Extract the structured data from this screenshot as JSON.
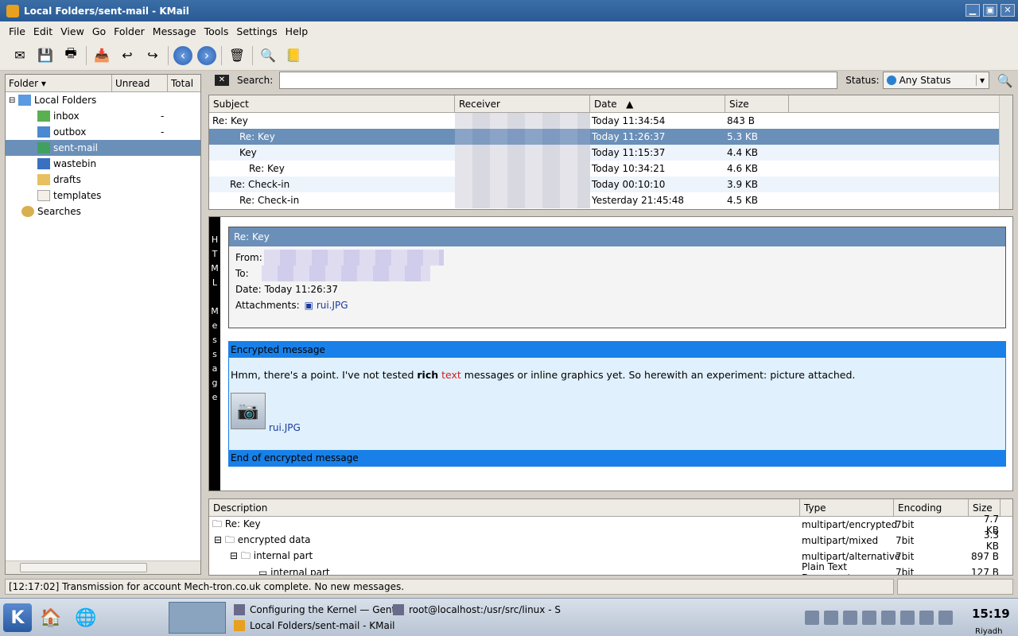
{
  "window": {
    "title": "Local Folders/sent-mail - KMail",
    "minimize": "▁",
    "maximize": "▣",
    "close": "✕"
  },
  "menu": [
    "File",
    "Edit",
    "View",
    "Go",
    "Folder",
    "Message",
    "Tools",
    "Settings",
    "Help"
  ],
  "folder_pane": {
    "headers": {
      "folder": "Folder",
      "unread": "Unread",
      "total": "Total"
    },
    "items": [
      {
        "label": "Local Folders",
        "unread": ""
      },
      {
        "label": "inbox",
        "unread": "-"
      },
      {
        "label": "outbox",
        "unread": "-"
      },
      {
        "label": "sent-mail",
        "unread": ""
      },
      {
        "label": "wastebin",
        "unread": ""
      },
      {
        "label": "drafts",
        "unread": ""
      },
      {
        "label": "templates",
        "unread": ""
      },
      {
        "label": "Searches",
        "unread": ""
      }
    ]
  },
  "search": {
    "label": "Search:",
    "value": "",
    "status_label": "Status:",
    "status_value": "Any Status"
  },
  "message_list": {
    "headers": {
      "subject": "Subject",
      "receiver": "Receiver",
      "date": "Date",
      "size": "Size"
    },
    "rows": [
      {
        "subject": "Re: Key",
        "date": "Today 11:34:54",
        "size": "843 B"
      },
      {
        "subject": "Re: Key",
        "date": "Today 11:26:37",
        "size": "5.3 KB"
      },
      {
        "subject": "Key",
        "date": "Today 11:15:37",
        "size": "4.4 KB"
      },
      {
        "subject": "Re: Key",
        "date": "Today 10:34:21",
        "size": "4.6 KB"
      },
      {
        "subject": "Re: Check-in",
        "date": "Today 00:10:10",
        "size": "3.9 KB"
      },
      {
        "subject": "Re: Check-in",
        "date": "Yesterday 21:45:48",
        "size": "4.5 KB"
      }
    ]
  },
  "reader": {
    "side_label": "HTML Message",
    "subject": "Re: Key",
    "from_label": "From:",
    "to_label": "To:",
    "date_label": "Date:",
    "date_value": "Today 11:26:37",
    "attachments_label": "Attachments:",
    "attachment_name": "rui.JPG",
    "encrypted_start": "Encrypted message",
    "body_pre": "Hmm, there's a point. I've not tested ",
    "body_bold": "rich",
    "body_red": "text",
    "body_post": " messages or inline graphics yet. So herewith an experiment: picture attached.",
    "picture_link": "rui.JPG",
    "encrypted_end": "End of encrypted message"
  },
  "parts": {
    "headers": {
      "description": "Description",
      "type": "Type",
      "encoding": "Encoding",
      "size": "Size"
    },
    "rows": [
      {
        "description": "Re: Key",
        "type": "multipart/encrypted",
        "encoding": "7bit",
        "size": "7.7 KB"
      },
      {
        "description": "encrypted data",
        "type": "multipart/mixed",
        "encoding": "7bit",
        "size": "3.3 KB"
      },
      {
        "description": "internal part",
        "type": "multipart/alternative",
        "encoding": "7bit",
        "size": "897 B"
      },
      {
        "description": "internal part",
        "type": "Plain Text Document",
        "encoding": "7bit",
        "size": "127 B"
      }
    ]
  },
  "status_bar": "[12:17:02] Transmission for account Mech-tron.co.uk complete. No new messages.",
  "taskbar": {
    "tasks": [
      "Configuring the Kernel — Gento",
      "root@localhost:/usr/src/linux - S",
      "Local Folders/sent-mail - KMail"
    ],
    "clock": "15:19",
    "place": "Riyadh"
  }
}
